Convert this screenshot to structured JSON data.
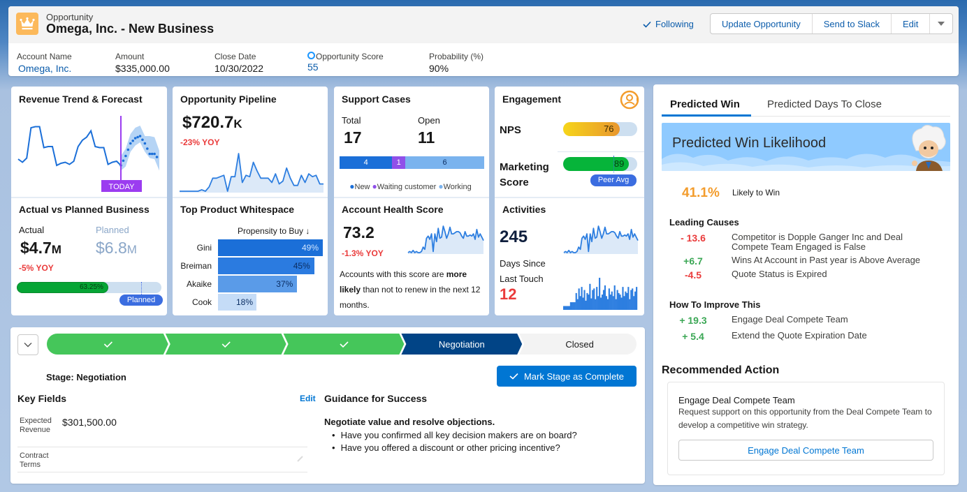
{
  "header": {
    "object_type": "Opportunity",
    "title": "Omega, Inc. - New Business",
    "icon": "crown-icon",
    "icon_color": "#fcb95b",
    "following_label": "Following",
    "actions": [
      "Update Opportunity",
      "Send to Slack",
      "Edit"
    ],
    "more_icon": "caret-down-icon",
    "highlights": [
      {
        "label": "Account Name",
        "value": "Omega, Inc.",
        "link": true
      },
      {
        "label": "Amount",
        "value": "$335,000.00",
        "link": false
      },
      {
        "label": "Close Date",
        "value": "10/30/2022",
        "link": false
      },
      {
        "label": "Opportunity Score",
        "value": "55",
        "link": true
      },
      {
        "label": "Probability (%)",
        "value": "90%",
        "link": false
      }
    ]
  },
  "tiles": {
    "revenue_trend": {
      "title": "Revenue Trend & Forecast",
      "today_label": "TODAY",
      "actual": [
        40,
        37,
        41,
        70,
        71,
        71,
        51,
        52,
        52,
        34,
        36,
        37,
        35,
        38,
        52,
        58,
        61,
        67,
        52,
        51,
        51,
        35,
        37,
        38,
        34
      ],
      "forecast": [
        34,
        43,
        55,
        60,
        62,
        55,
        45,
        45,
        39
      ],
      "forecast_upper": [
        43,
        50,
        64,
        70,
        72,
        62,
        62,
        61,
        48
      ],
      "forecast_lower": [
        29,
        33,
        47,
        53,
        56,
        47,
        41,
        40,
        29
      ]
    },
    "pipeline": {
      "title": "Opportunity Pipeline",
      "value": "$720.7",
      "value_suffix": "K",
      "yoy": "-23% YOY",
      "series": [
        2,
        2,
        2,
        2,
        2,
        2,
        3,
        2,
        5,
        11,
        11,
        12,
        13,
        2,
        12,
        12,
        28,
        8,
        13,
        12,
        22,
        16,
        11,
        11,
        11,
        8,
        14,
        7,
        9,
        18,
        11,
        6,
        6,
        13,
        8,
        14,
        12,
        13,
        7,
        7
      ]
    },
    "support_cases": {
      "title": "Support Cases",
      "total_label": "Total",
      "total": "17",
      "open_label": "Open",
      "open": "11",
      "segments": [
        {
          "name": "New",
          "value": 4,
          "color": "#1b6fd8"
        },
        {
          "name": "Waiting customer",
          "value": 1,
          "color": "#9050e9"
        },
        {
          "name": "Working",
          "value": 6,
          "color": "#7ab3ee"
        }
      ]
    },
    "engagement": {
      "title": "Engagement",
      "icon": "user-refresh-icon",
      "nps_label": "NPS",
      "nps_value": 76,
      "nps_max": 100,
      "marketing_label_1": "Marketing",
      "marketing_label_2": "Score",
      "marketing_value": 89,
      "marketing_max": 100,
      "peer_avg_label": "Peer Avg",
      "peer_avg_value": 68
    },
    "actual_vs_planned": {
      "title": "Actual vs Planned Business",
      "actual_label": "Actual",
      "actual_value": "$4.7",
      "actual_suffix": "M",
      "planned_label": "Planned",
      "planned_value": "$6.8",
      "planned_suffix": "M",
      "yoy": "-5% YOY",
      "progress_pct": 63.25,
      "progress_label": "63.25%",
      "planned_marker_label": "Planned",
      "planned_marker_pct": 86
    },
    "whitespace": {
      "title": "Top Product Whitespace",
      "header": "Propensity to Buy ↓",
      "rows": [
        {
          "name": "Gini",
          "value": 49,
          "label": "49%",
          "color": "#1b6fd8",
          "text_color": "#cfe4ff"
        },
        {
          "name": "Breiman",
          "value": 45,
          "label": "45%",
          "color": "#2b7be0",
          "text_color": "#0b2e63"
        },
        {
          "name": "Akaike",
          "value": 37,
          "label": "37%",
          "color": "#5a9be8",
          "text_color": "#0b2e63"
        },
        {
          "name": "Cook",
          "value": 18,
          "label": "18%",
          "color": "#c5dcf7",
          "text_color": "#0b2e63"
        }
      ]
    },
    "health": {
      "title": "Account Health Score",
      "value": "73.2",
      "yoy": "-1.3% YOY",
      "desc_pre": "Accounts with this score are ",
      "desc_bold": "more likely",
      "desc_post": " than not to renew in the next 12  months.",
      "series": [
        3,
        4,
        3,
        5,
        3,
        4,
        3,
        3,
        4,
        8,
        6,
        16,
        18,
        15,
        20,
        4,
        20,
        13,
        25,
        16,
        17,
        27,
        22,
        16,
        20,
        26,
        20,
        20,
        21,
        22,
        22,
        21,
        18,
        16,
        22,
        18,
        18,
        19,
        18,
        20,
        15,
        24,
        17,
        20,
        17,
        14
      ]
    },
    "activities": {
      "title": "Activities",
      "value": "245",
      "days_label_1": "Days Since",
      "days_label_2": "Last Touch",
      "days_value": "12",
      "series": [
        3,
        4,
        3,
        5,
        3,
        4,
        3,
        3,
        4,
        8,
        6,
        16,
        18,
        15,
        20,
        4,
        20,
        13,
        25,
        16,
        17,
        27,
        22,
        16,
        20,
        26,
        20,
        20,
        21,
        22,
        22,
        21,
        18,
        16,
        22,
        18,
        18,
        19,
        18,
        20,
        15,
        24,
        17,
        20,
        17,
        14
      ],
      "bars": [
        5,
        5,
        5,
        5,
        5,
        10,
        10,
        10,
        10,
        22,
        14,
        28,
        18,
        30,
        16,
        26,
        12,
        22,
        20,
        34,
        15,
        26,
        28,
        14,
        30,
        18,
        42,
        16,
        20,
        26,
        32,
        18,
        14,
        28,
        20,
        24,
        18,
        32,
        14,
        26,
        22,
        20,
        16,
        30,
        18,
        24,
        22,
        30,
        14,
        26,
        28,
        18,
        24,
        30
      ]
    }
  },
  "path": {
    "toggle_icon": "chevron-down-icon",
    "stages": [
      {
        "label": "",
        "state": "complete"
      },
      {
        "label": "",
        "state": "complete"
      },
      {
        "label": "",
        "state": "complete"
      },
      {
        "label": "Negotiation",
        "state": "current"
      },
      {
        "label": "Closed",
        "state": "incomplete"
      }
    ],
    "stage_label": "Stage: Negotiation",
    "mark_complete_label": "Mark Stage as Complete",
    "key_fields_title": "Key Fields",
    "key_fields_edit": "Edit",
    "key_fields": [
      {
        "label": "Expected Revenue",
        "value": "$301,500.00"
      },
      {
        "label": "Contract Terms",
        "value": ""
      }
    ],
    "guidance_title": "Guidance for Success",
    "guidance_heading": "Negotiate value and resolve objections.",
    "guidance_items": [
      "Have you confirmed all key decision makers are on board?",
      "Have you offered a discount or other pricing incentive?"
    ]
  },
  "prediction": {
    "tabs": [
      "Predicted Win",
      "Predicted Days To Close"
    ],
    "active_tab": 0,
    "banner_title": "Predicted Win Likelihood",
    "likelihood": "41.1%",
    "likelihood_label": "Likely to Win",
    "leading_causes_title": "Leading Causes",
    "leading_causes": [
      {
        "value": "- 13.6",
        "sign": "neg",
        "text": "Competitor is Dopple Ganger Inc and Deal Compete Team Engaged is False"
      },
      {
        "value": "+6.7",
        "sign": "pos",
        "text": "Wins At Account in Past year is Above Average"
      },
      {
        "value": "-4.5",
        "sign": "neg",
        "text": "Quote Status is Expired"
      }
    ],
    "improve_title": "How To Improve This",
    "improvements": [
      {
        "value": "+ 19.3",
        "sign": "pos",
        "text": "Engage Deal Compete Team"
      },
      {
        "value": "+ 5.4",
        "sign": "pos",
        "text": "Extend the Quote Expiration Date"
      }
    ],
    "recommended_title": "Recommended Action",
    "rec_heading": "Engage Deal Compete Team",
    "rec_desc": "Request support on this opportunity from the Deal Compete Team to develop a competitive win strategy.",
    "rec_button": "Engage Deal Compete Team"
  },
  "colors": {
    "brand": "#0176d3",
    "link": "#0b5cab",
    "path_complete": "#45c65a",
    "path_current": "#014486",
    "path_incomplete": "#f3f3f3",
    "negative": "#ea3b3b",
    "positive": "#2e844a",
    "today": "#9b3cf0"
  }
}
